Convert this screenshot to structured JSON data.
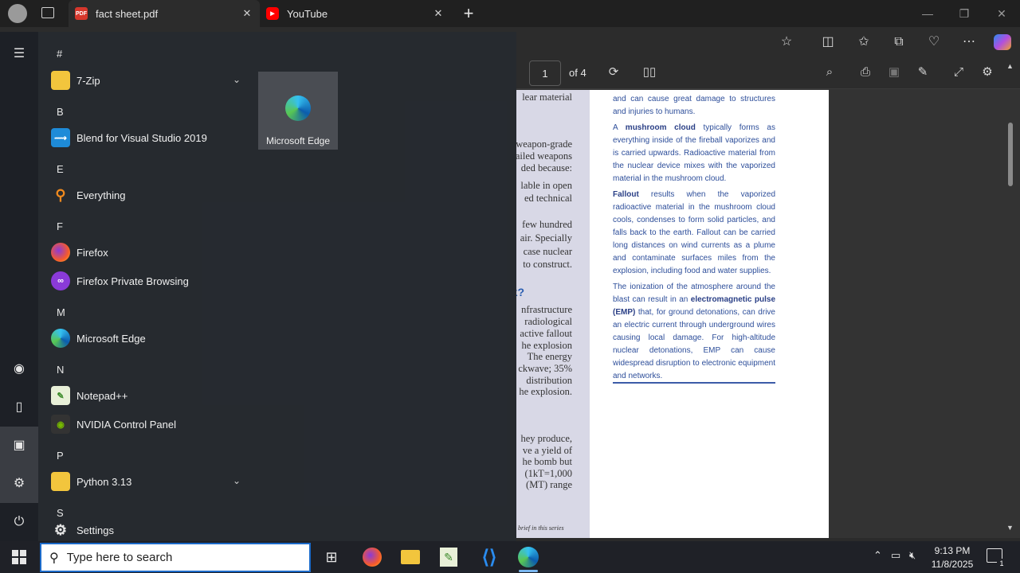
{
  "browser": {
    "tabs": [
      {
        "label": "fact sheet.pdf",
        "favicon": "pdf-icon",
        "active": true
      },
      {
        "label": "YouTube",
        "favicon": "youtube-icon",
        "active": false
      }
    ],
    "new_tab": "+"
  },
  "pdf": {
    "page_number": "1",
    "page_of": "of 4",
    "left_column_lines": [
      "lear material",
      "weapon-grade",
      "ailed weapons",
      "ded because:",
      "lable in open",
      "ed technical",
      "few hundred",
      "air. Specially",
      "case nuclear",
      "to construct.",
      "k?",
      "nfrastructure",
      "radiological",
      "active fallout",
      "he explosion",
      "The energy",
      "ckwave; 35%",
      "distribution",
      "he explosion.",
      "hey produce,",
      "ve a yield of",
      "he bomb but",
      "(1kT=1,000",
      "(MT) range",
      "brief in this series"
    ],
    "right_paragraphs": {
      "p0": "and can cause great damage to structures and injuries to humans.",
      "p1_pre": "A ",
      "p1_term": "mushroom cloud",
      "p1_post": " typically forms as everything inside of the fireball vaporizes and is carried upwards. Radioactive material from the nuclear device mixes with the vaporized material in the mushroom cloud.",
      "p2_term": "Fallout",
      "p2_post": " results when the vaporized radioactive material in the mushroom cloud cools, condenses to form solid particles, and falls back to the earth. Fallout can be carried long distances on wind currents as a plume and contaminate surfaces miles from the explosion, including food and water supplies.",
      "p3_pre": "The ionization of the atmosphere around the blast can result in an ",
      "p3_term": "electromagnetic pulse (EMP)",
      "p3_post": " that, for ground detonations, can drive an electric current through underground wires causing local damage. For high-altitude nuclear detonations, EMP can cause widespread disruption to electronic equipment and networks."
    }
  },
  "start_menu": {
    "sections": [
      {
        "letter": "#",
        "apps": [
          {
            "label": "7-Zip",
            "icon": "folder-icon",
            "expandable": true
          }
        ]
      },
      {
        "letter": "B",
        "apps": [
          {
            "label": "Blend for Visual Studio 2019",
            "icon": "blend-icon"
          }
        ]
      },
      {
        "letter": "E",
        "apps": [
          {
            "label": "Everything",
            "icon": "everything-icon"
          }
        ]
      },
      {
        "letter": "F",
        "apps": [
          {
            "label": "Firefox",
            "icon": "firefox-icon"
          },
          {
            "label": "Firefox Private Browsing",
            "icon": "firefox-private-icon"
          }
        ]
      },
      {
        "letter": "M",
        "apps": [
          {
            "label": "Microsoft Edge",
            "icon": "edge-icon"
          }
        ]
      },
      {
        "letter": "N",
        "apps": [
          {
            "label": "Notepad++",
            "icon": "notepadpp-icon"
          },
          {
            "label": "NVIDIA Control Panel",
            "icon": "nvidia-icon"
          }
        ]
      },
      {
        "letter": "P",
        "apps": [
          {
            "label": "Python 3.13",
            "icon": "folder-icon",
            "expandable": true
          }
        ]
      },
      {
        "letter": "S",
        "apps": [
          {
            "label": "Settings",
            "icon": "gear-icon"
          }
        ]
      }
    ],
    "tile": {
      "label": "Microsoft Edge",
      "icon": "edge-icon"
    }
  },
  "taskbar": {
    "search_placeholder": "Type here to search",
    "time": "9:13 PM",
    "date": "11/8/2025",
    "notification_count": "1"
  }
}
